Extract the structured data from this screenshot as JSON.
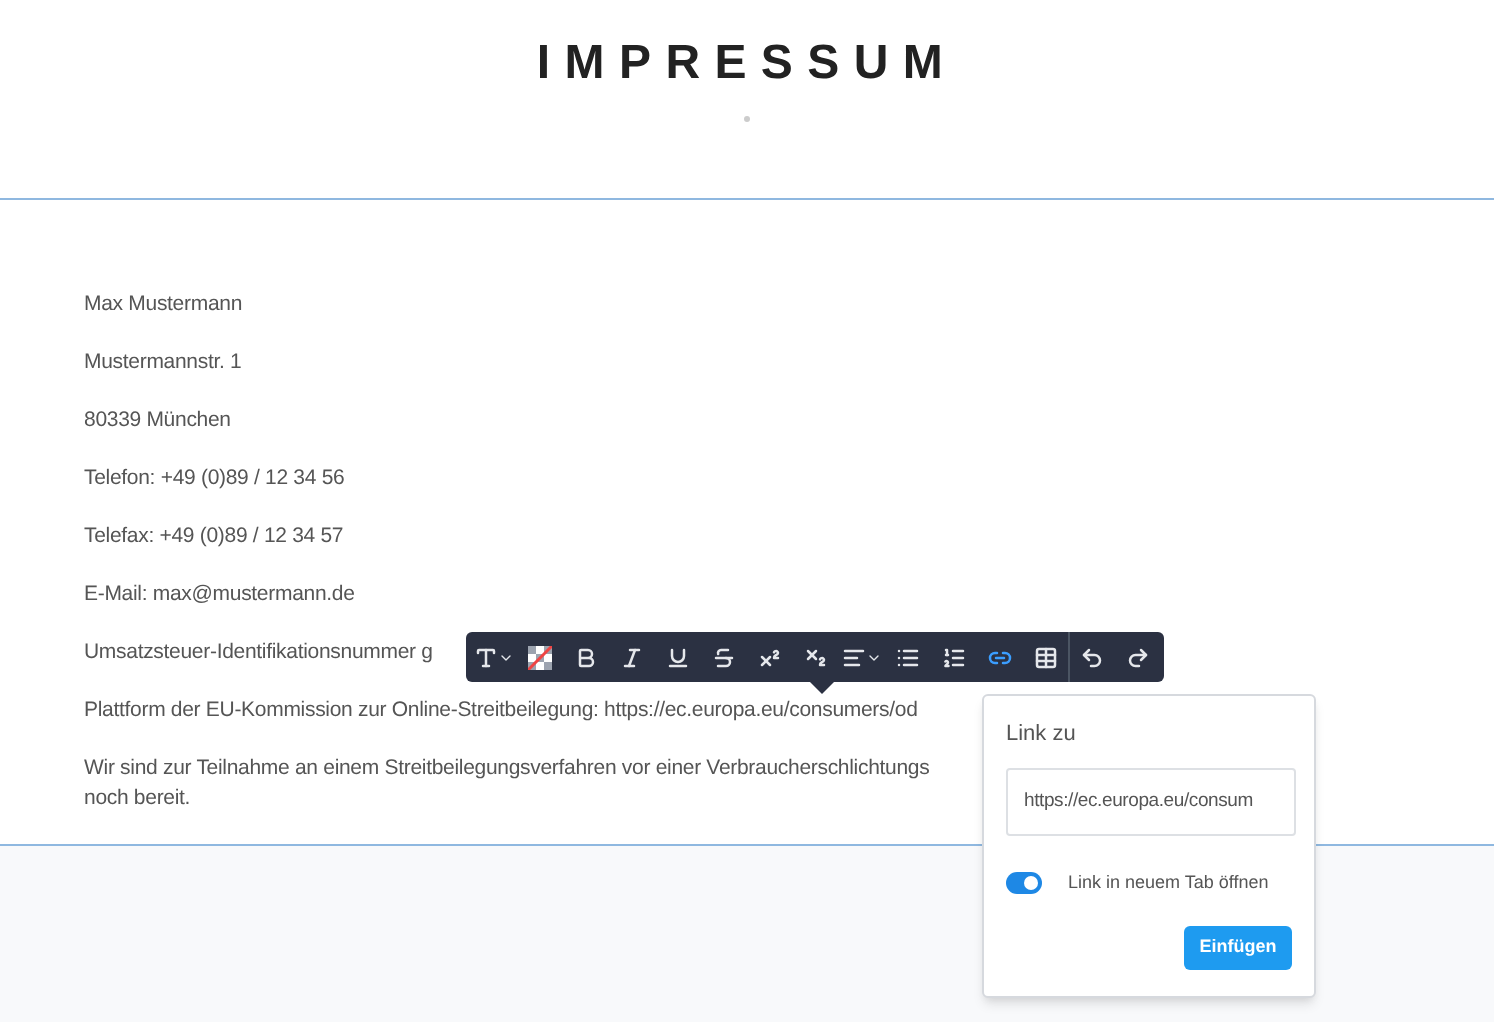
{
  "page": {
    "title": "IMPRESSUM"
  },
  "paragraphs": [
    "Max Mustermann",
    "Mustermannstr. 1",
    "80339 München",
    "Telefon: +49 (0)89 / 12 34 56",
    "Telefax: +49 (0)89 / 12 34 57",
    "E-Mail: max@mustermann.de",
    "Umsatzsteuer-Identifikationsnummer g",
    "Plattform der EU-Kommission zur Online-Streitbeilegung: https://ec.europa.eu/consumers/od",
    "Wir sind zur Teilnahme an einem Streitbeilegungsverfahren vor einer Verbraucherschlichtungs\nnoch bereit."
  ],
  "toolbar": [
    {
      "kind": "font",
      "active": false
    },
    {
      "kind": "color",
      "active": false
    },
    {
      "kind": "bold",
      "active": false
    },
    {
      "kind": "italic",
      "active": false
    },
    {
      "kind": "underline",
      "active": false
    },
    {
      "kind": "strike",
      "active": false
    },
    {
      "kind": "superscript",
      "active": false
    },
    {
      "kind": "subscript",
      "active": false
    },
    {
      "kind": "align",
      "active": false
    },
    {
      "kind": "bullets",
      "active": false
    },
    {
      "kind": "numbers",
      "active": false
    },
    {
      "kind": "link",
      "active": true
    },
    {
      "kind": "table",
      "active": false
    },
    {
      "kind": "undo",
      "active": false
    },
    {
      "kind": "redo",
      "active": false
    }
  ],
  "link_popup": {
    "label": "Link zu",
    "url": "https://ec.europa.eu/consum",
    "new_tab": {
      "label": "Link in neuem Tab öffnen",
      "on": true
    },
    "button": "Einfügen"
  }
}
